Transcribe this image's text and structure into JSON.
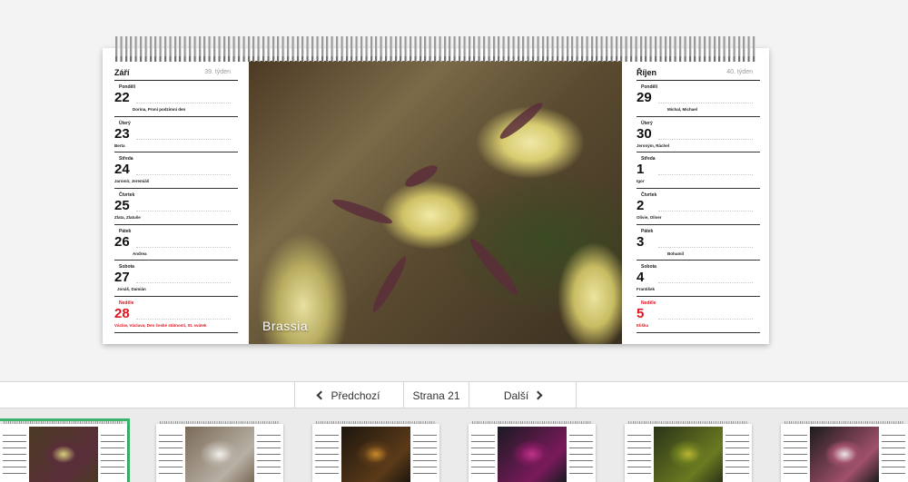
{
  "left_week": {
    "month": "Září",
    "week_label": "39. týden",
    "days": [
      {
        "weekday": "Pondělí",
        "number": "22",
        "names": "Dorina, První podzimní den"
      },
      {
        "weekday": "Úterý",
        "number": "23",
        "names": "Berta"
      },
      {
        "weekday": "Středa",
        "number": "24",
        "names": "Jaromír, Jeremiáš"
      },
      {
        "weekday": "Čtvrtek",
        "number": "25",
        "names": "Zlata, Zlatuše"
      },
      {
        "weekday": "Pátek",
        "number": "26",
        "names": "Andrea"
      },
      {
        "weekday": "Sobota",
        "number": "27",
        "names": "Jonáš, Damián"
      },
      {
        "weekday": "Neděle",
        "number": "28",
        "names": "Václav, Václava, Den české státnosti, St. svátek"
      }
    ]
  },
  "right_week": {
    "month": "Říjen",
    "week_label": "40. týden",
    "days": [
      {
        "weekday": "Pondělí",
        "number": "29",
        "names": "Michal, Michael"
      },
      {
        "weekday": "Úterý",
        "number": "30",
        "names": "Jeroným, Ráchel"
      },
      {
        "weekday": "Středa",
        "number": "1",
        "names": "Igor"
      },
      {
        "weekday": "Čtvrtek",
        "number": "2",
        "names": "Olivie, Oliver"
      },
      {
        "weekday": "Pátek",
        "number": "3",
        "names": "Bohumil"
      },
      {
        "weekday": "Sobota",
        "number": "4",
        "names": "František"
      },
      {
        "weekday": "Neděle",
        "number": "5",
        "names": "Eliška"
      }
    ]
  },
  "photo": {
    "caption": "Brassia"
  },
  "pager": {
    "prev_label": "Předchozí",
    "page_label": "Strana 21",
    "next_label": "Další"
  },
  "thumbnails": [
    {
      "name": "thumbnail-21",
      "active": true,
      "colors": [
        "#4a3a22",
        "#d9cf7e",
        "#5a2e3a"
      ]
    },
    {
      "name": "thumbnail-22",
      "active": false,
      "colors": [
        "#7a6a58",
        "#f4f2ee",
        "#b8b0a4"
      ]
    },
    {
      "name": "thumbnail-23",
      "active": false,
      "colors": [
        "#1e160e",
        "#c98a2a",
        "#5a3a18"
      ]
    },
    {
      "name": "thumbnail-24",
      "active": false,
      "colors": [
        "#1a1a22",
        "#c0338a",
        "#7a1a5a"
      ]
    },
    {
      "name": "thumbnail-25",
      "active": false,
      "colors": [
        "#2a3418",
        "#b8b430",
        "#6a7a20"
      ]
    },
    {
      "name": "thumbnail-26",
      "active": false,
      "colors": [
        "#1c1c1c",
        "#ece6ea",
        "#a0506a"
      ]
    }
  ],
  "colors": {
    "accent_active": "#3bb36b",
    "sunday": "#e0141e"
  }
}
